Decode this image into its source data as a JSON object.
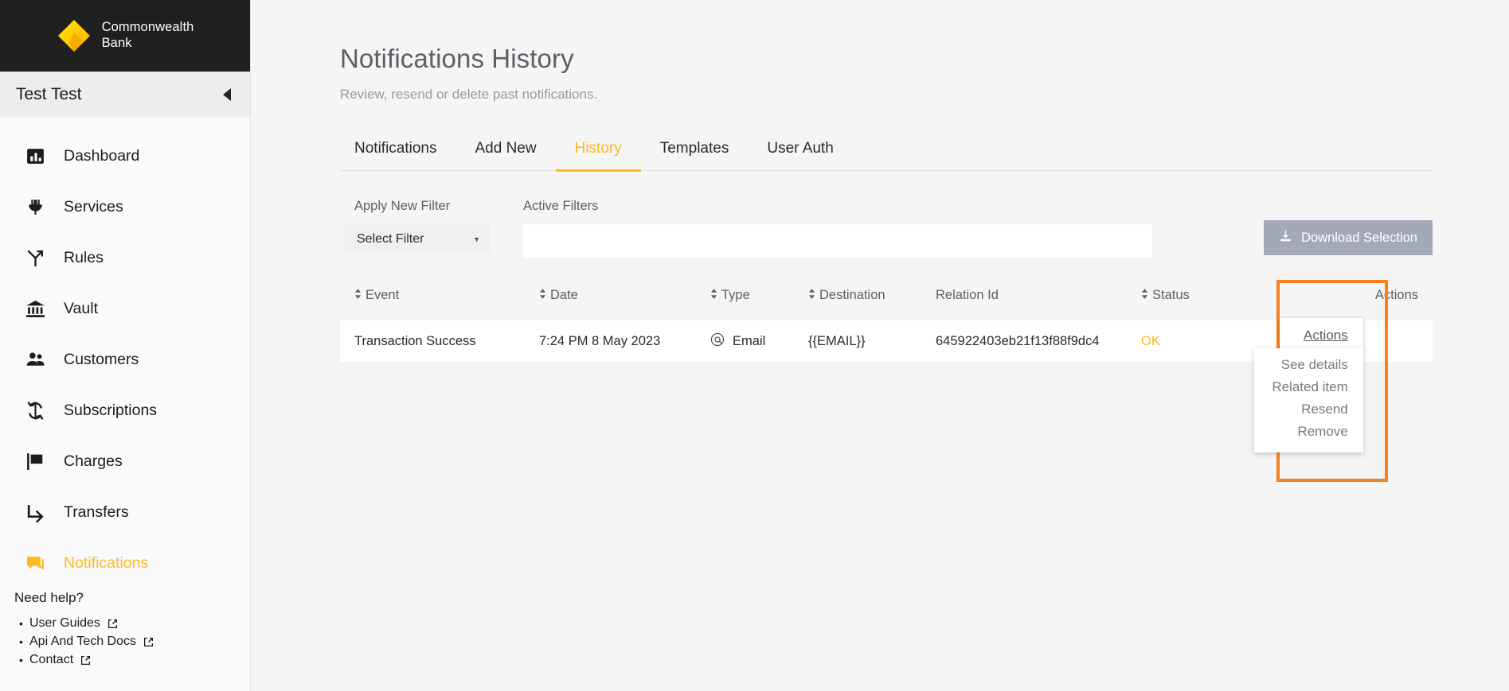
{
  "brand": {
    "name_line1": "Commonwealth",
    "name_line2": "Bank",
    "logo_icon": "diamond-logo-icon",
    "colors": {
      "accent": "#ffb81c",
      "highlight": "#f58220",
      "dark": "#1f1f1f",
      "muted": "#5b6067"
    }
  },
  "sidebar": {
    "user_name": "Test Test",
    "collapse_icon": "chevron-left-icon",
    "items": [
      {
        "label": "Dashboard",
        "icon": "bar-chart-icon",
        "active": false
      },
      {
        "label": "Services",
        "icon": "plug-icon",
        "active": false
      },
      {
        "label": "Rules",
        "icon": "branch-fork-icon",
        "active": false
      },
      {
        "label": "Vault",
        "icon": "bank-icon",
        "active": false
      },
      {
        "label": "Customers",
        "icon": "people-icon",
        "active": false
      },
      {
        "label": "Subscriptions",
        "icon": "refresh-cycle-icon",
        "active": false
      },
      {
        "label": "Charges",
        "icon": "flag-icon",
        "active": false
      },
      {
        "label": "Transfers",
        "icon": "arrow-turn-right-icon",
        "active": false
      },
      {
        "label": "Notifications",
        "icon": "chat-bubble-icon",
        "active": true
      }
    ],
    "help": {
      "title": "Need help?",
      "links": [
        {
          "label": "User Guides",
          "icon": "external-link-icon"
        },
        {
          "label": "Api And Tech Docs",
          "icon": "external-link-icon"
        },
        {
          "label": "Contact",
          "icon": "external-link-icon"
        }
      ]
    }
  },
  "page": {
    "title": "Notifications History",
    "subtitle": "Review, resend or delete past notifications."
  },
  "tabs": [
    {
      "label": "Notifications",
      "active": false
    },
    {
      "label": "Add New",
      "active": false
    },
    {
      "label": "History",
      "active": true
    },
    {
      "label": "Templates",
      "active": false
    },
    {
      "label": "User Auth",
      "active": false
    }
  ],
  "filters": {
    "apply_label": "Apply New Filter",
    "select_value": "Select Filter",
    "caret_icon": "caret-down-icon",
    "active_label": "Active Filters",
    "active_value": "",
    "download_label": "Download Selection",
    "download_icon": "download-icon"
  },
  "table": {
    "columns": [
      {
        "label": "Event",
        "sortable": true,
        "sort_icon": "sort-updown-icon"
      },
      {
        "label": "Date",
        "sortable": true,
        "sort_icon": "sort-updown-icon"
      },
      {
        "label": "Type",
        "sortable": true,
        "sort_icon": "sort-updown-icon"
      },
      {
        "label": "Destination",
        "sortable": true,
        "sort_icon": "sort-updown-icon"
      },
      {
        "label": "Relation Id",
        "sortable": false,
        "sort_icon": ""
      },
      {
        "label": "Status",
        "sortable": true,
        "sort_icon": "sort-updown-icon"
      },
      {
        "label": "Actions",
        "sortable": false,
        "sort_icon": ""
      }
    ],
    "rows": [
      {
        "event": "Transaction Success",
        "date": "7:24 PM 8 May 2023",
        "type": "Email",
        "type_icon": "at-sign-circle-icon",
        "destination": "{{EMAIL}}",
        "relation_id": "645922403eb21f13f88f9dc4",
        "status": "OK"
      }
    ]
  },
  "actions_menu": {
    "trigger_label": "Actions",
    "items": [
      {
        "label": "See details"
      },
      {
        "label": "Related item"
      },
      {
        "label": "Resend"
      },
      {
        "label": "Remove"
      }
    ]
  }
}
